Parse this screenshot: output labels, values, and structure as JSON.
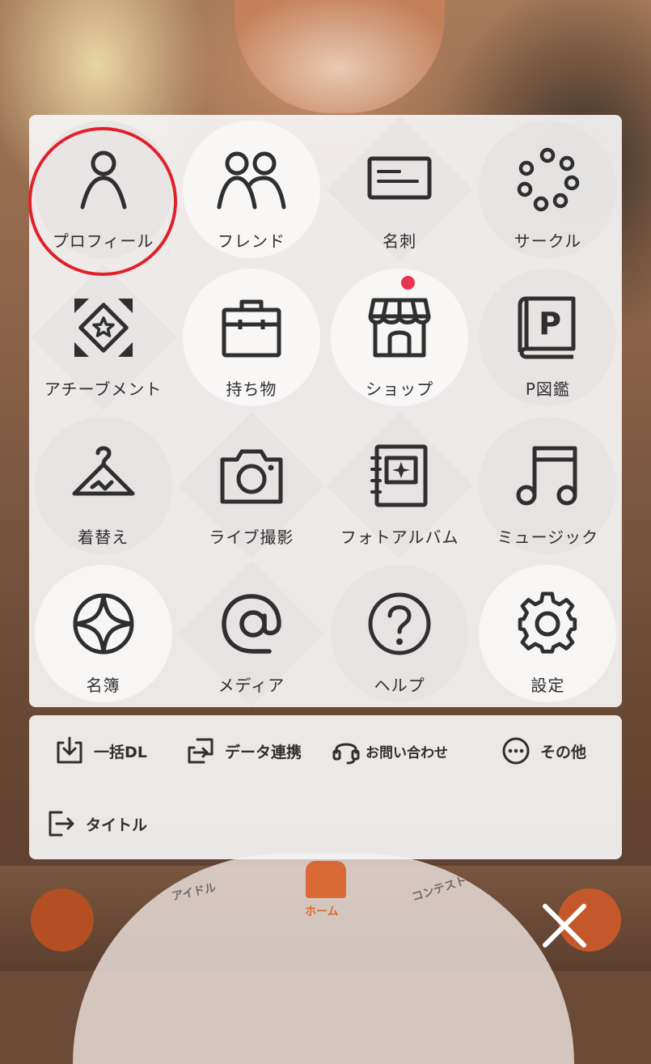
{
  "menu": {
    "items": [
      {
        "label": "プロフィール",
        "icon": "person-icon"
      },
      {
        "label": "フレンド",
        "icon": "friends-icon"
      },
      {
        "label": "名刺",
        "icon": "business-card-icon"
      },
      {
        "label": "サークル",
        "icon": "circle-dots-icon"
      },
      {
        "label": "アチーブメント",
        "icon": "achievement-star-icon"
      },
      {
        "label": "持ち物",
        "icon": "bag-icon"
      },
      {
        "label": "ショップ",
        "icon": "shop-icon"
      },
      {
        "label": "P図鑑",
        "icon": "p-book-icon"
      },
      {
        "label": "着替え",
        "icon": "hanger-icon"
      },
      {
        "label": "ライブ撮影",
        "icon": "camera-icon"
      },
      {
        "label": "フォトアルバム",
        "icon": "photo-album-icon"
      },
      {
        "label": "ミュージック",
        "icon": "music-note-icon"
      },
      {
        "label": "名簿",
        "icon": "roster-diamond-icon"
      },
      {
        "label": "メディア",
        "icon": "at-sign-icon"
      },
      {
        "label": "ヘルプ",
        "icon": "question-icon"
      },
      {
        "label": "設定",
        "icon": "gear-icon"
      }
    ]
  },
  "sub_menu": {
    "bulk_dl": "一括DL",
    "data_link": "データ連携",
    "contact": "お問い合わせ",
    "other": "その他",
    "title": "タイトル"
  },
  "bottom_nav": {
    "idol": "アイドル",
    "home": "ホーム",
    "contest": "コンテスト"
  },
  "colors": {
    "highlight_ring": "#e0202a",
    "notification_dot": "#ea3350",
    "icon_stroke": "#2f2f2f"
  }
}
